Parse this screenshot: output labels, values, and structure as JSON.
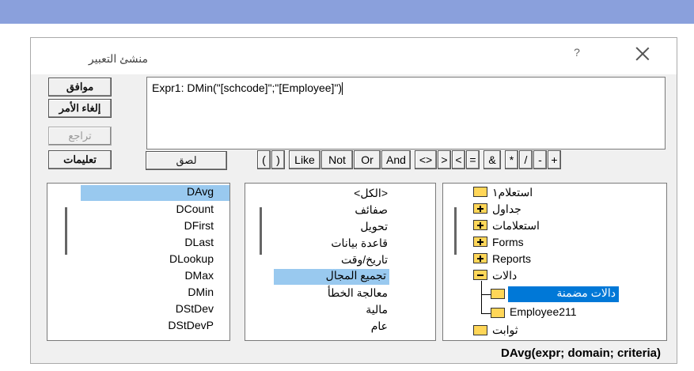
{
  "dialog": {
    "title": "منشئ التعبير",
    "help": "?"
  },
  "buttons": {
    "ok": "موافق",
    "cancel": "إلغاء الأمر",
    "undo": "تراجع",
    "help": "تعليمات",
    "paste": "لصق"
  },
  "expression": "Expr1: DMin(\"[schcode]\";\"[Employee]\")",
  "operators": [
    "(",
    ")",
    "Like",
    "Not",
    "Or",
    "And",
    "<>",
    ">",
    "<",
    "=",
    "&",
    "*",
    "/",
    "-",
    "+"
  ],
  "left_list": [
    "DAvg",
    "DCount",
    "DFirst",
    "DLast",
    "DLookup",
    "DMax",
    "DMin",
    "DStDev",
    "DStDevP"
  ],
  "middle_list": [
    "<الكل>",
    "صفائف",
    "تحويل",
    "قاعدة بيانات",
    "تاريخ/وقت",
    "تجميع المجال",
    "معالجة الخطأ",
    "مالية",
    "عام"
  ],
  "tree": [
    "استعلام١",
    "جداول",
    "استعلامات",
    "Forms",
    "Reports",
    "دالات",
    "دالات مضمنة",
    "Employee211",
    "ثوابت"
  ],
  "status": "DAvg(expr; domain; criteria)"
}
